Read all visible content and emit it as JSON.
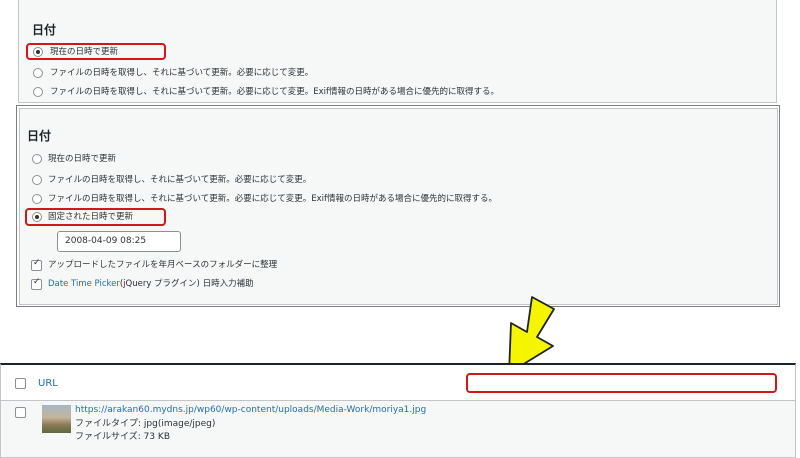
{
  "panel_before": {
    "heading": "日付",
    "options": [
      "現在の日時で更新",
      "ファイルの日時を取得し、それに基づいて更新。必要に応じて変更。",
      "ファイルの日時を取得し、それに基づいて更新。必要に応じて変更。Exif情報の日時がある場合に優先的に取得する。"
    ],
    "selected_index": 0
  },
  "panel_after": {
    "heading": "日付",
    "options": [
      "現在の日時で更新",
      "ファイルの日時を取得し、それに基づいて更新。必要に応じて変更。",
      "ファイルの日時を取得し、それに基づいて更新。必要に応じて変更。Exif情報の日時がある場合に優先的に取得する。",
      "固定された日時で更新"
    ],
    "selected_index": 3,
    "date_value": "2008-04-09 08:25",
    "checkbox1_label": "アップロードしたファイルを年月ベースのフォルダーに整理",
    "checkbox2_link": "Date Time Picker",
    "checkbox2_rest": "(jQuery プラグイン) 日時入力補助"
  },
  "arrow_icon": "arrow-down-left-icon",
  "arrow_color": "#f5f500",
  "highlight_color": "#d01818",
  "media_table": {
    "header": "URL",
    "row": {
      "url": "https://arakan60.mydns.jp/wp60/wp-content/uploads/Media-Work/moriya1.jpg",
      "file_type": "ファイルタイプ: jpg(image/jpeg)",
      "file_size": "ファイルサイズ: 73 KB"
    }
  }
}
